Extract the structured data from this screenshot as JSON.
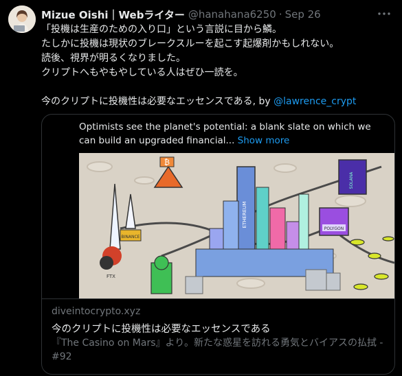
{
  "tweet": {
    "author_name": "Mizue Oishi｜Webライター",
    "handle": "@hanahana6250",
    "separator": "·",
    "date": "Sep 26",
    "lines": [
      "「投機は生産のための入り口」という言説に目から鱗。",
      "たしかに投機は現状のブレークスルーを起こす起爆剤かもしれない。",
      "読後、視界が明るくなりました。",
      "クリプトへもやもやしている人はぜひ一読を。"
    ],
    "last_line_prefix": "今のクリプトに投機性は必要なエッセンスである, by ",
    "mention": "@lawrence_crypt"
  },
  "card": {
    "description": "Optimists see the planet's potential: a blank slate on which we can build an upgraded financial...",
    "show_more": "Show more",
    "domain": "diveintocrypto.xyz",
    "title": "今のクリプトに投機性は必要なエッセンスである",
    "subtitle": "『The Casino on Mars』より。新たな惑星を訪れる勇気とバイアスの払拭 - #92",
    "image_signs": {
      "ethereum": "ETHEREUM",
      "solana": "SOLANA",
      "polygon": "POLYGON",
      "ftx": "FTX",
      "binance": "BINANCE",
      "bitcoin_symbol": "₿"
    }
  },
  "icons": {
    "more": "more-horizontal-icon"
  }
}
